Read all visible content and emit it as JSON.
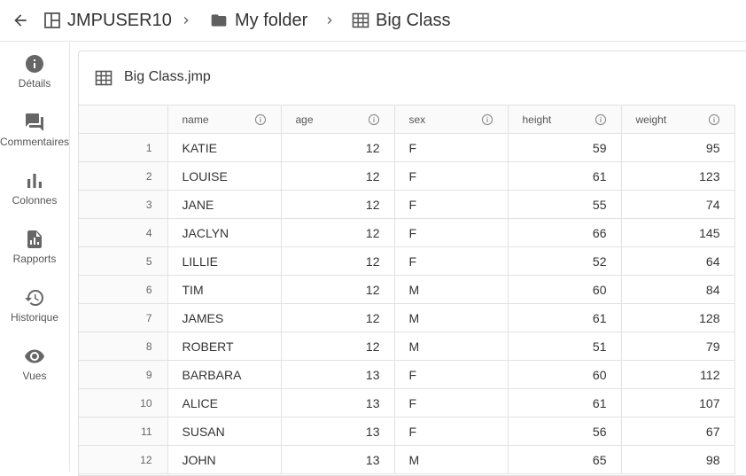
{
  "breadcrumb": {
    "items": [
      {
        "label": "JMPUSER10",
        "icon": "space-icon"
      },
      {
        "label": "My folder",
        "icon": "folder-icon"
      },
      {
        "label": "Big Class",
        "icon": "table-icon"
      }
    ]
  },
  "rail": {
    "items": [
      {
        "label": "Détails",
        "icon": "info-icon"
      },
      {
        "label": "Commentaires",
        "icon": "comments-icon"
      },
      {
        "label": "Colonnes",
        "icon": "columns-chart-icon"
      },
      {
        "label": "Rapports",
        "icon": "report-icon"
      },
      {
        "label": "Historique",
        "icon": "history-icon"
      },
      {
        "label": "Vues",
        "icon": "eye-icon"
      }
    ]
  },
  "panel": {
    "title": "Big Class.jmp"
  },
  "table": {
    "columns": [
      {
        "label": "name",
        "align": "left"
      },
      {
        "label": "age",
        "align": "right"
      },
      {
        "label": "sex",
        "align": "left"
      },
      {
        "label": "height",
        "align": "right"
      },
      {
        "label": "weight",
        "align": "right"
      }
    ],
    "rows": [
      {
        "n": "1",
        "cells": [
          "KATIE",
          "12",
          "F",
          "59",
          "95"
        ]
      },
      {
        "n": "2",
        "cells": [
          "LOUISE",
          "12",
          "F",
          "61",
          "123"
        ]
      },
      {
        "n": "3",
        "cells": [
          "JANE",
          "12",
          "F",
          "55",
          "74"
        ]
      },
      {
        "n": "4",
        "cells": [
          "JACLYN",
          "12",
          "F",
          "66",
          "145"
        ]
      },
      {
        "n": "5",
        "cells": [
          "LILLIE",
          "12",
          "F",
          "52",
          "64"
        ]
      },
      {
        "n": "6",
        "cells": [
          "TIM",
          "12",
          "M",
          "60",
          "84"
        ]
      },
      {
        "n": "7",
        "cells": [
          "JAMES",
          "12",
          "M",
          "61",
          "128"
        ]
      },
      {
        "n": "8",
        "cells": [
          "ROBERT",
          "12",
          "M",
          "51",
          "79"
        ]
      },
      {
        "n": "9",
        "cells": [
          "BARBARA",
          "13",
          "F",
          "60",
          "112"
        ]
      },
      {
        "n": "10",
        "cells": [
          "ALICE",
          "13",
          "F",
          "61",
          "107"
        ]
      },
      {
        "n": "11",
        "cells": [
          "SUSAN",
          "13",
          "F",
          "56",
          "67"
        ]
      },
      {
        "n": "12",
        "cells": [
          "JOHN",
          "13",
          "M",
          "65",
          "98"
        ]
      }
    ]
  }
}
